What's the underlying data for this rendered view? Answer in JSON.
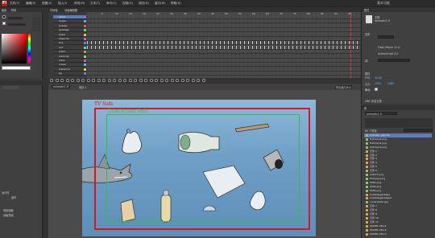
{
  "app": {
    "logo": "Fl"
  },
  "menu": [
    "文件(F)",
    "编辑(E)",
    "视图(V)",
    "插入(I)",
    "修改(M)",
    "文本(T)",
    "命令(C)",
    "控制(O)",
    "调试(D)",
    "窗口(W)",
    "帮助(H)"
  ],
  "workspace": "基本功能",
  "color_panel": {
    "tabs": [
      "颜色",
      "样本"
    ]
  },
  "timeline": {
    "tabs": [
      "时间轴",
      "动画编辑器"
    ],
    "layers": [
      "Artist",
      "helper",
      "bubble",
      "garbage",
      "shark",
      "shark fin",
      "boy",
      "net",
      "shark",
      "plant bg",
      "stars",
      "ocean",
      "waterline",
      "bg"
    ],
    "frame_numbers": [
      "5",
      "10",
      "15",
      "20",
      "25",
      "30",
      "35",
      "40",
      "45",
      "50",
      "55",
      "60",
      "65",
      "70",
      "75",
      "80",
      "85",
      "90",
      "95"
    ]
  },
  "stage": {
    "scene": "场景 1",
    "zoom": "符合窗口大小",
    "tv_safe": "TV Safe",
    "action_safe": "Title/Action Safe"
  },
  "properties": {
    "tab": "属性",
    "doc_type": "文档",
    "doc_name": "animatic1.fl",
    "publish_label": "发布",
    "player": "Flash Player 11.0",
    "script": "ActionScript 3.0",
    "class_label": "类:",
    "props_label": "属性",
    "fps_label": "FPS:",
    "fps": "30.00",
    "size_label": "大小:",
    "size": "1920",
    "size2": "1080",
    "stage_label": "舞台:",
    "swf_label": "SWF 历史记录"
  },
  "library": {
    "tab": "库",
    "file": "animatic1.fl",
    "count": "63 个项目",
    "search_placeholder": "",
    "items": [
      "animatic plan.fla",
      "Fishmen1.png",
      "Fishmen2.png",
      "Fishmen3.png",
      "元件 1",
      "元件 2",
      "元件 3",
      "元件 4",
      "元件 5",
      "元件 6",
      "shark2.png",
      "Fishmen.png",
      "Wifi1.png",
      "Wifi2.png",
      "Wifi3.png",
      "bubble&garbage",
      "bubble&garbage2",
      "underwater.jpg",
      "元件 7",
      "元件 8",
      "元件 9",
      "元件 10",
      "元件 11",
      "WATER CELL1",
      "WATER CELL2",
      "WATER CELL3"
    ]
  },
  "left_bottom": {
    "label1": "运行时",
    "label2": "部件",
    "sub1": "场景面板",
    "sub2": "动画预设"
  }
}
